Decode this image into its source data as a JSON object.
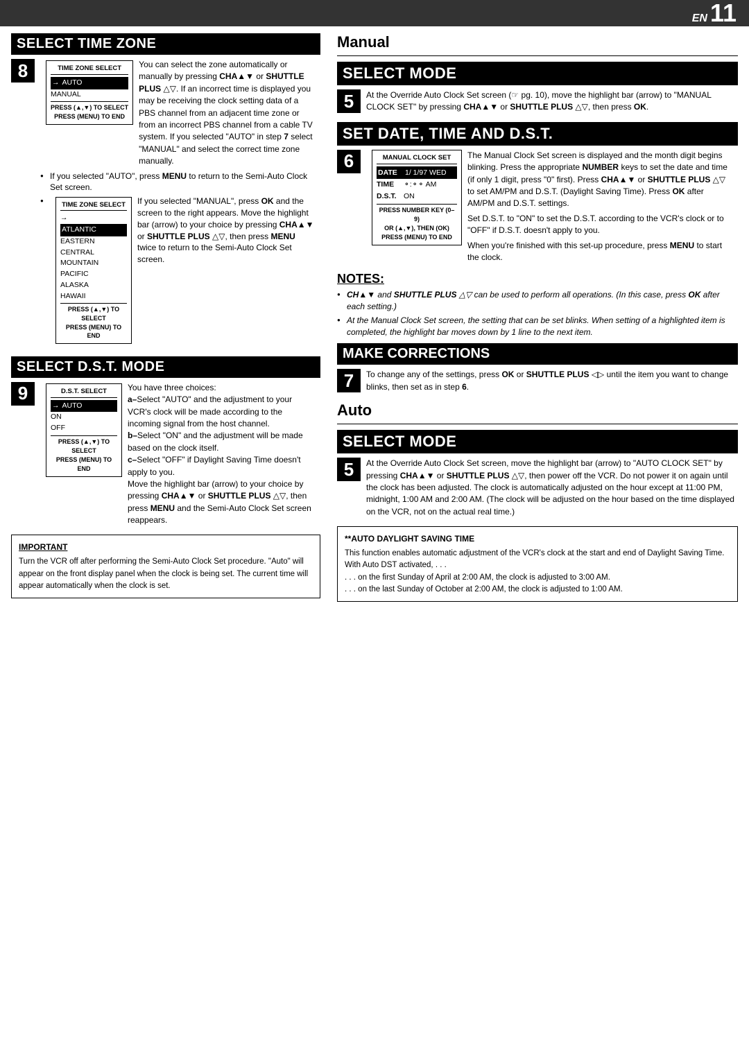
{
  "header": {
    "en_label": "EN",
    "page_number": "11"
  },
  "left": {
    "section8": {
      "title": "SELECT TIME ZONE",
      "step_num": "8",
      "text1": "You can select the zone automatically or manually by pressing ",
      "cha": "CHA",
      "updown1": "▲▼",
      "or1": " or",
      "shuttle": " SHUTTLE PLUS ",
      "delta": "△▽",
      "text2": ". If an incorrect time is displayed you may be receiving the clock setting data of a PBS channel from an adjacent time zone or from an incorrect PBS channel from a cable TV system. If you selected \"AUTO\" in step ",
      "bold_7": "7",
      "text3": " select \"MANUAL\" and select the correct time zone manually.",
      "box1": {
        "title": "TIME ZONE SELECT",
        "arrow": "→",
        "row1": "AUTO",
        "row2": "MANUAL",
        "press": "PRESS (▲,▼) TO SELECT\nPRESS (MENU) TO END"
      },
      "bullet1": "If you selected \"AUTO\", press MENU to return to the Semi-Auto Clock Set screen.",
      "bullet2_intro": "If you selected \"MANUAL\", press ",
      "bullet2_ok": "OK",
      "bullet2_rest": " and the screen to the right appears. Move the highlight bar (arrow) to your choice by pressing ",
      "bullet2_cha": "CHA",
      "bullet2_updown": "▲▼",
      "bullet2_or": " or ",
      "bullet2_shuttle": "SHUTTLE",
      "bullet2_plus": " PLUS ",
      "bullet2_delta": "△▽",
      "bullet2_end": ", then press MENU twice to return to the Semi-Auto Clock Set screen.",
      "box2": {
        "title": "TIME ZONE SELECT",
        "arrow": "→",
        "row_selected": "ATLANTIC",
        "rows": [
          "EASTERN",
          "CENTRAL",
          "MOUNTAIN",
          "PACIFIC",
          "ALASKA",
          "HAWAII"
        ],
        "press": "PRESS (▲,▼) TO SELECT\nPRESS (MENU) TO END"
      }
    },
    "section9": {
      "title": "SELECT D.S.T. MODE",
      "step_num": "9",
      "intro": "You have three choices:",
      "a_text": "a–Select \"AUTO\" and the adjustment to your VCR's clock will be made according to the incoming signal from the host channel.",
      "b_text": "b–Select \"ON\" and the adjustment will be made based on the clock itself.",
      "c_text": "c–Select \"OFF\" if Daylight Saving Time doesn't apply to you.",
      "move_text": "Move the highlight bar (arrow) to your choice by pressing ",
      "cha": "CHA",
      "updown": "▲▼",
      "or": " or ",
      "shuttle": "SHUTTLE PLUS ",
      "delta": "△▽",
      "then": ", then press",
      "menu_end": " MENU and the Semi-Auto Clock Set screen reappears.",
      "box": {
        "title": "D.S.T. SELECT",
        "arrow": "→",
        "row_selected": "AUTO",
        "rows": [
          "ON",
          "OFF"
        ],
        "press": "PRESS (▲,▼) TO SELECT\nPRESS (MENU) TO END"
      }
    },
    "important_box": {
      "title": "IMPORTANT",
      "text": "Turn the VCR off after performing the Semi-Auto Clock Set procedure. \"Auto\" will appear on the front display panel when the clock is being set. The current time will appear automatically when the clock is set."
    }
  },
  "right": {
    "manual_label": "Manual",
    "section5_manual": {
      "title": "SELECT MODE",
      "step_num": "5",
      "text": "At the Override Auto Clock Set screen (☞ pg. 10), move the highlight bar (arrow) to \"MANUAL CLOCK SET\" by pressing ",
      "cha": "CHA",
      "updown": "▲▼",
      "or": " or ",
      "shuttle": "SHUTTLE PLUS ",
      "delta": "△▽",
      "end": ", then press ",
      "ok": "OK",
      "period": "."
    },
    "section6": {
      "title": "SET DATE, TIME AND D.S.T.",
      "step_num": "6",
      "text1": "The Manual Clock Set screen is displayed and the month digit begins blinking. Press the appropriate ",
      "number": "NUMBER",
      "text2": " keys to set the date and time (if only 1 digit, press \"0\" first). Press ",
      "cha": "CHA",
      "updown": "▲▼",
      "or": " or ",
      "shuttle": "SHUTTLE",
      "plus": " PLUS ",
      "delta": "△▽",
      "ampm": " to set AM/PM and D.S.T. (Daylight Saving Time). Press ",
      "ok2": "OK",
      "text3": " after AM/PM and D.S.T. settings.",
      "text4": "Set D.S.T. to \"ON\" to set the D.S.T. according to the VCR's clock or to \"OFF\" if D.S.T. doesn't apply to you.",
      "text5": "When you're finished with this set-up procedure, press MENU to start the clock.",
      "box": {
        "title": "MANUAL CLOCK SET",
        "rows": [
          {
            "label": "DATE",
            "value": "1/ 1/97  WED",
            "highlighted": true
          },
          {
            "label": "TIME",
            "value": "⊙:⊙⊙  AM",
            "highlighted": false
          },
          {
            "label": "D.S.T.",
            "value": "ON",
            "highlighted": false
          }
        ],
        "press1": "PRESS NUMBER KEY (0–9)",
        "press2": "OR (▲,▼), THEN (OK)",
        "press3": "PRESS (MENU) TO END"
      }
    },
    "notes": {
      "title": "NOTES:",
      "bullet1": "CHA▲▼ and SHUTTLE PLUS △▽ can be used to perform all operations. (In this case, press OK after each setting.)",
      "bullet2": "At the Manual Clock Set screen, the setting that can be set blinks. When setting of a highlighted item is completed, the highlight bar moves down by 1 line to the next item."
    },
    "make_corrections": {
      "title": "MAKE CORRECTIONS",
      "step_num": "7",
      "text": "To change any of the settings, press ",
      "ok": "OK",
      "or": " or ",
      "shuttle": "SHUTTLE PLUS ",
      "delta": "◁▷",
      "end": " until the item you want to change blinks, then set as in step ",
      "bold6": "6",
      "period": "."
    },
    "auto_label": "Auto",
    "section5_auto": {
      "title": "SELECT MODE",
      "step_num": "5",
      "text1": "At the Override Auto Clock Set screen, move the highlight bar (arrow) to \"AUTO CLOCK SET\" by pressing ",
      "cha": "CHA",
      "updown": "▲▼",
      "or": " or ",
      "shuttle": "SHUTTLE PLUS ",
      "delta": "△▽",
      "text2": ", then power off the VCR. Do not power it on again until the clock has been adjusted. The clock is automatically adjusted on the hour except at 11:00 PM, midnight, 1:00 AM and 2:00 AM. (The clock will be adjusted on the hour based on the time displayed on the VCR, not on the actual real time.)"
    },
    "auto_dst_box": {
      "title": "**AUTO DAYLIGHT SAVING TIME",
      "text1": "This function enables automatic adjustment of the VCR's clock at the start and end of Daylight Saving Time.",
      "text2": "With Auto DST activated, . . .",
      "bullet1": ". . . on the first Sunday of April at 2:00 AM, the clock is adjusted to 3:00 AM.",
      "bullet2": ". . . on the last Sunday of October at 2:00 AM, the clock is adjusted to 1:00 AM."
    }
  }
}
